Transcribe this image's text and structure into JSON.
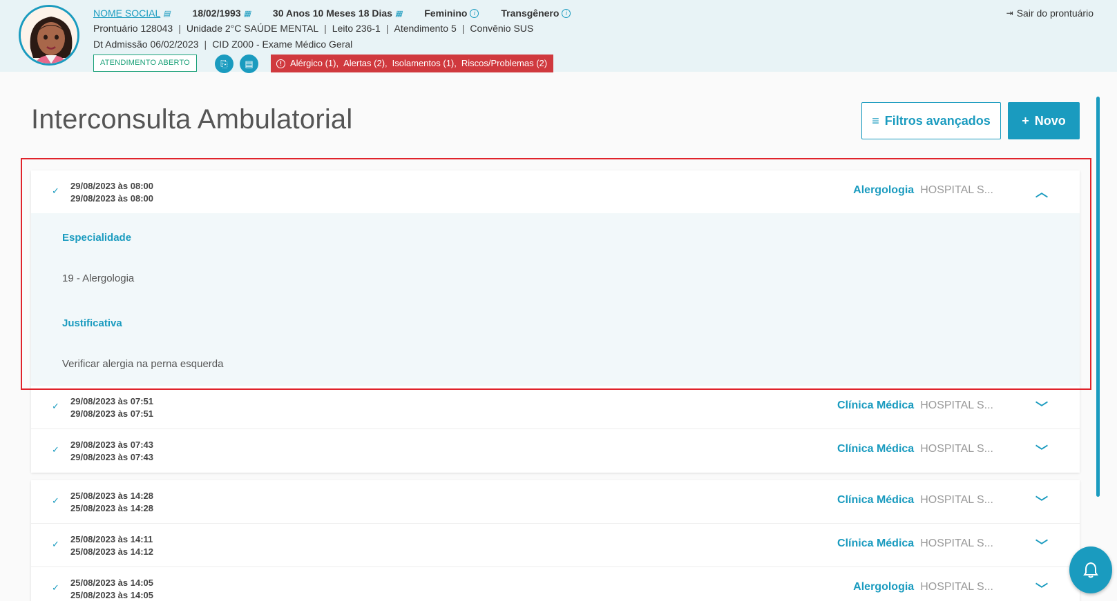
{
  "patient": {
    "social_name": "NOME SOCIAL",
    "birth_date": "18/02/1993",
    "age": "30 Anos 10 Meses 18 Dias",
    "sex": "Feminino",
    "gender": "Transgênero",
    "prontuario": "Prontuário 128043",
    "unidade": "Unidade 2°C SAÚDE MENTAL",
    "leito": "Leito 236-1",
    "atendimento": "Atendimento 5",
    "convenio": "Convênio SUS",
    "admissao": "Dt Admissão 06/02/2023",
    "cid": "CID Z000 - Exame Médico Geral",
    "status": "ATENDIMENTO ABERTO",
    "alerts": {
      "alergico": "Alérgico (1),",
      "alertas": "Alertas (2),",
      "isolamentos": "Isolamentos (1),",
      "riscos": "Riscos/Problemas (2)"
    },
    "exit_label": "Sair do prontuário",
    "separator": "|"
  },
  "page": {
    "title": "Interconsulta Ambulatorial",
    "filter_label": "Filtros avançados",
    "new_label": "Novo"
  },
  "expanded_detail": {
    "especialidade_label": "Especialidade",
    "especialidade_value": "19 - Alergologia",
    "justificativa_label": "Justificativa",
    "justificativa_value": "Verificar alergia na perna esquerda"
  },
  "group1": [
    {
      "date1": "29/08/2023 às 08:00",
      "date2": "29/08/2023 às 08:00",
      "specialty": "Alergologia",
      "hospital": "HOSPITAL S..."
    },
    {
      "date1": "29/08/2023 às 07:51",
      "date2": "29/08/2023 às 07:51",
      "specialty": "Clínica Médica",
      "hospital": "HOSPITAL S..."
    },
    {
      "date1": "29/08/2023 às 07:43",
      "date2": "29/08/2023 às 07:43",
      "specialty": "Clínica Médica",
      "hospital": "HOSPITAL S..."
    }
  ],
  "group2": [
    {
      "date1": "25/08/2023 às 14:28",
      "date2": "25/08/2023 às 14:28",
      "specialty": "Clínica Médica",
      "hospital": "HOSPITAL S..."
    },
    {
      "date1": "25/08/2023 às 14:11",
      "date2": "25/08/2023 às 14:12",
      "specialty": "Clínica Médica",
      "hospital": "HOSPITAL S..."
    },
    {
      "date1": "25/08/2023 às 14:05",
      "date2": "25/08/2023 às 14:05",
      "specialty": "Alergologia",
      "hospital": "HOSPITAL S..."
    }
  ],
  "colors": {
    "primary": "#1a9bbf",
    "alert": "#d0393e",
    "status_green": "#1aa078",
    "highlight_red": "#e0232b"
  }
}
